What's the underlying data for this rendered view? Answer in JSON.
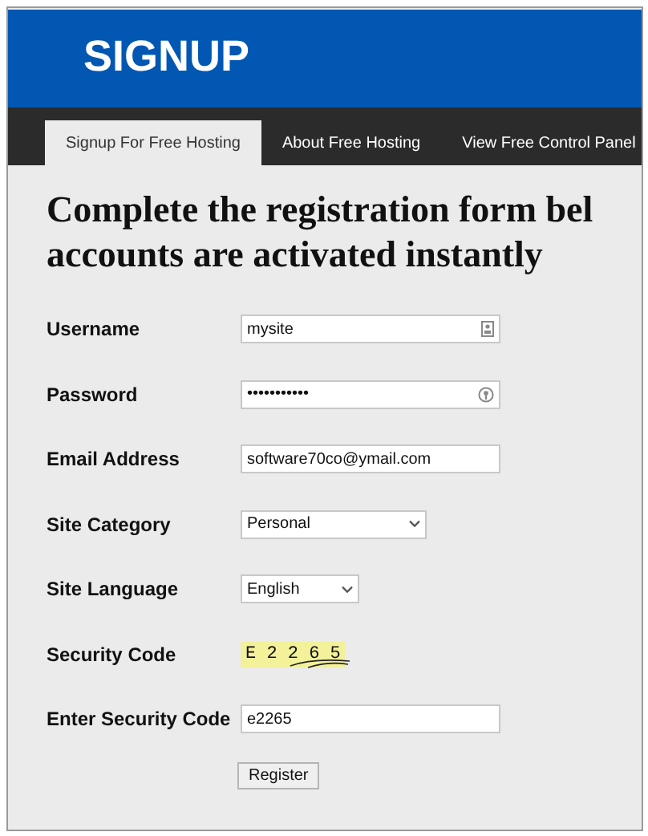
{
  "header": {
    "title": "SIGNUP"
  },
  "tabs": [
    {
      "label": "Signup For Free Hosting",
      "selected": true
    },
    {
      "label": "About Free Hosting",
      "selected": false
    },
    {
      "label": "View Free Control Panel",
      "selected": false
    }
  ],
  "heading": [
    "Complete the registration form bel",
    "accounts are activated instantly"
  ],
  "fields": [
    {
      "kind": "text",
      "label": "Username",
      "value": "mysite"
    },
    {
      "kind": "text",
      "label": "Password",
      "value": "•••••••••••"
    },
    {
      "kind": "text",
      "label": "Email Address",
      "value": "software70co@ymail.com"
    },
    {
      "kind": "select",
      "label": "Site Category",
      "value": "Personal"
    },
    {
      "kind": "select",
      "label": "Site Language",
      "value": "English"
    },
    {
      "kind": "captcha",
      "label": "Security Code",
      "value": "E 2 2 6 5"
    },
    {
      "kind": "text",
      "label": "Enter Security Code",
      "value": "e2265"
    }
  ],
  "button": "Register"
}
